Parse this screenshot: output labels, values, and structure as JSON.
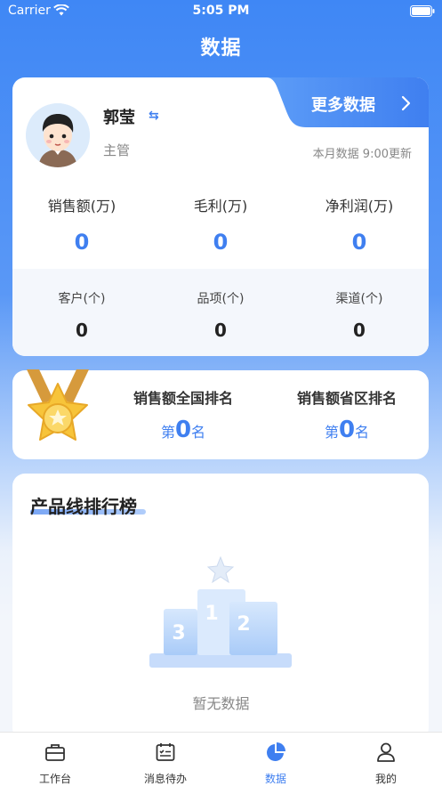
{
  "status_bar": {
    "carrier": "Carrier",
    "time": "5:05 PM"
  },
  "header": {
    "title": "数据"
  },
  "profile": {
    "name": "郭莹",
    "switch_icon": "⇆",
    "role": "主管",
    "more_label": "更多数据",
    "update_note": "本月数据 9:00更新"
  },
  "main_stats": [
    {
      "label": "销售额(万)",
      "value": "0"
    },
    {
      "label": "毛利(万)",
      "value": "0"
    },
    {
      "label": "净利润(万)",
      "value": "0"
    }
  ],
  "sub_stats": [
    {
      "label": "客户(个)",
      "value": "0"
    },
    {
      "label": "品项(个)",
      "value": "0"
    },
    {
      "label": "渠道(个)",
      "value": "0"
    }
  ],
  "ranking": [
    {
      "label": "销售额全国排名",
      "prefix": "第",
      "value": "0",
      "suffix": "名"
    },
    {
      "label": "销售额省区排名",
      "prefix": "第",
      "value": "0",
      "suffix": "名"
    }
  ],
  "product_board": {
    "title": "产品线排行榜",
    "empty_text": "暂无数据"
  },
  "tab_bar": [
    {
      "label": "工作台",
      "icon": "briefcase-icon"
    },
    {
      "label": "消息待办",
      "icon": "todo-list-icon"
    },
    {
      "label": "数据",
      "icon": "pie-chart-icon"
    },
    {
      "label": "我的",
      "icon": "person-icon"
    }
  ],
  "colors": {
    "primary": "#3f7ff0",
    "background_top": "#3f87f5"
  }
}
